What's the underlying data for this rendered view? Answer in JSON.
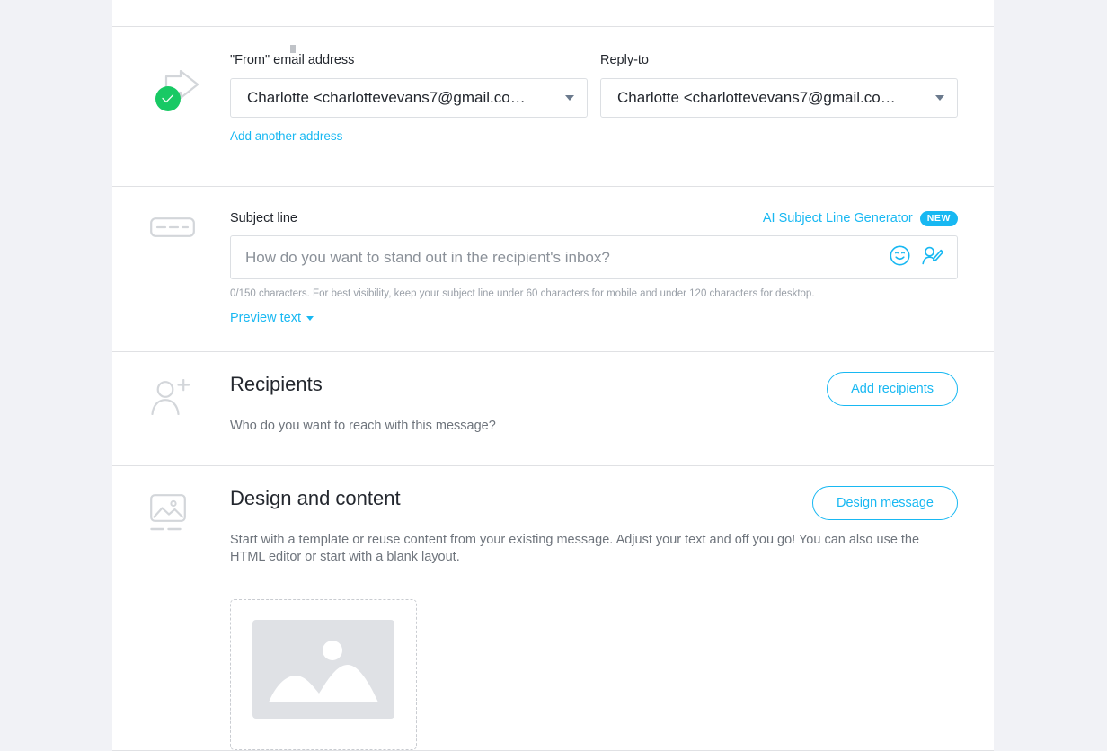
{
  "theme": {
    "accent": "#18b8f2",
    "success_green": "#18c964",
    "page_bg": "#f1f2f6",
    "panel_bg": "#ffffff",
    "text_primary": "#23272e",
    "text_muted": "#6e747c",
    "border": "#dcdfe3"
  },
  "from_section": {
    "icon": "share-arrow-icon",
    "status_icon": "green-check-circle-icon",
    "from_label": "\"From\" email address",
    "from_value": "Charlotte <charlottevevans7@gmail.co…",
    "add_another_link": "Add another address",
    "replyto_label": "Reply-to",
    "replyto_value": "Charlotte <charlottevevans7@gmail.co…"
  },
  "subject_section": {
    "icon": "subject-line-icon",
    "title": "Subject line",
    "ai_generator_label": "AI Subject Line Generator",
    "ai_generator_badge": "NEW",
    "input_value": "",
    "input_placeholder": "How do you want to stand out in the recipient's inbox?",
    "emoji_icon": "smiley-face-icon",
    "personalize_icon": "person-edit-icon",
    "hint": "0/150 characters. For best visibility, keep your subject line under 60 characters for mobile and under 120 characters for desktop.",
    "preview_text_label": "Preview text"
  },
  "recipients_section": {
    "icon": "person-add-icon",
    "title": "Recipients",
    "description": "Who do you want to reach with this message?",
    "button_label": "Add recipients"
  },
  "design_section": {
    "icon": "image-content-icon",
    "title": "Design and content",
    "description": "Start with a template or reuse content from your existing message. Adjust your text and off you go! You can also use the HTML editor or start with a blank layout.",
    "button_label": "Design message",
    "template_card": {
      "thumbnail_icon": "image-placeholder-icon"
    }
  }
}
